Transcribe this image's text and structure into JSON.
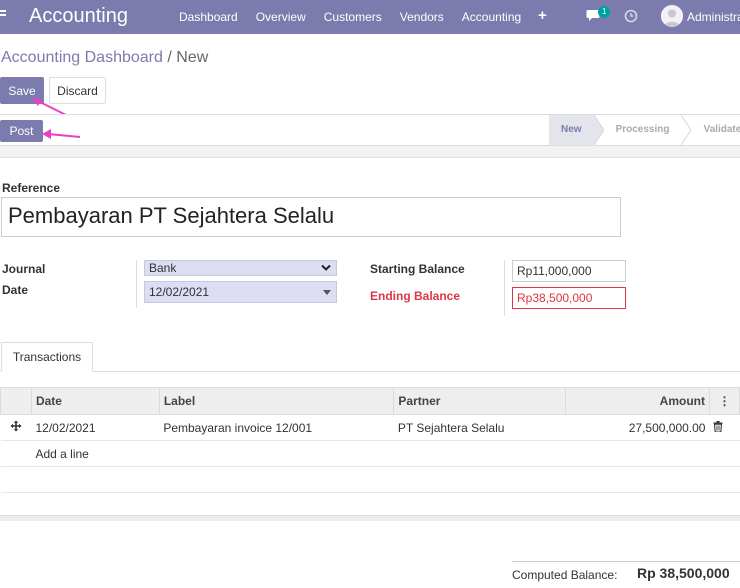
{
  "navbar": {
    "brand": "Accounting",
    "menu": [
      "Dashboard",
      "Overview",
      "Customers",
      "Vendors",
      "Accounting"
    ],
    "plus": "+",
    "chat_badge": "1",
    "user": "Administrator"
  },
  "breadcrumb": {
    "parent": "Accounting Dashboard",
    "separator": " / ",
    "current": "New"
  },
  "buttons": {
    "save": "Save",
    "discard": "Discard",
    "post": "Post"
  },
  "statusbar": {
    "stages": [
      "New",
      "Processing",
      "Validated"
    ],
    "active": "New"
  },
  "form": {
    "reference_label": "Reference",
    "reference_value": "Pembayaran PT Sejahtera Selalu",
    "journal_label": "Journal",
    "journal_value": "Bank",
    "date_label": "Date",
    "date_value": "12/02/2021",
    "starting_balance_label": "Starting Balance",
    "starting_balance_value": "Rp11,000,000",
    "ending_balance_label": "Ending Balance",
    "ending_balance_value": "Rp38,500,000"
  },
  "notebook": {
    "tab": "Transactions"
  },
  "lines": {
    "headers": {
      "date": "Date",
      "label": "Label",
      "partner": "Partner",
      "amount": "Amount",
      "options": "⋮"
    },
    "rows": [
      {
        "date": "12/02/2021",
        "label": "Pembayaran invoice 12/001",
        "partner": "PT Sejahtera Selalu",
        "amount": "27,500,000.00"
      }
    ],
    "add_line": "Add a line"
  },
  "computed": {
    "label": "Computed Balance:",
    "value": "Rp 38,500,000"
  },
  "colors": {
    "brand": "#7c7bad",
    "danger": "#dc3545",
    "annotation_arrow": "#e83fc6"
  },
  "icons": [
    "apps-menu-icon",
    "plus-icon",
    "chat-icon",
    "clock-icon",
    "avatar-icon",
    "drag-handle-icon",
    "trash-icon",
    "column-options-icon",
    "dropdown-caret-icon"
  ]
}
